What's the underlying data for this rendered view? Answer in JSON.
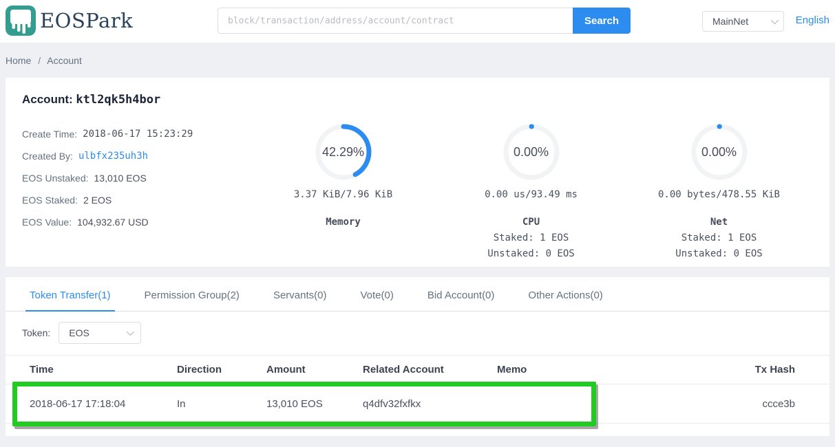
{
  "header": {
    "brand": "EOSPark",
    "search": {
      "placeholder": "block/transaction/address/account/contract",
      "button": "Search"
    },
    "network": "MainNet",
    "language": "English"
  },
  "breadcrumb": {
    "home": "Home",
    "separator": "/",
    "current": "Account"
  },
  "account": {
    "title_label": "Account:",
    "name": "ktl2qk5h4bor",
    "details": [
      {
        "label": "Create Time:",
        "value": "2018-06-17 15:23:29"
      },
      {
        "label": "Created By:",
        "value": "ulbfx235uh3h"
      },
      {
        "label": "EOS Unstaked:",
        "value": "13,010 EOS"
      },
      {
        "label": "EOS Staked:",
        "value": "2 EOS"
      },
      {
        "label": "EOS Value:",
        "value": "104,932.67 USD"
      }
    ],
    "gauges": [
      {
        "name": "Memory",
        "percent": 42.29,
        "percent_label": "42.29%",
        "usage": "3.37 KiB/7.96 KiB",
        "line1": "",
        "line2": ""
      },
      {
        "name": "CPU",
        "percent": 0,
        "percent_label": "0.00%",
        "usage": "0.00 us/93.49 ms",
        "line1": "Staked: 1 EOS",
        "line2": "Unstaked: 0 EOS"
      },
      {
        "name": "Net",
        "percent": 0,
        "percent_label": "0.00%",
        "usage": "0.00 bytes/478.55 KiB",
        "line1": "Staked: 1 EOS",
        "line2": "Unstaked: 0 EOS"
      }
    ]
  },
  "tabs": [
    {
      "label": "Token Transfer(1)",
      "active": true
    },
    {
      "label": "Permission Group(2)",
      "active": false
    },
    {
      "label": "Servants(0)",
      "active": false
    },
    {
      "label": "Vote(0)",
      "active": false
    },
    {
      "label": "Bid Account(0)",
      "active": false
    },
    {
      "label": "Other Actions(0)",
      "active": false
    }
  ],
  "token_filter": {
    "label": "Token:",
    "selected": "EOS"
  },
  "table": {
    "columns": [
      "Time",
      "Direction",
      "Amount",
      "Related Account",
      "Memo",
      "Tx Hash"
    ],
    "rows": [
      {
        "time": "2018-06-17 17:18:04",
        "direction": "In",
        "amount": "13,010 EOS",
        "related_account": "q4dfv32fxfkx",
        "memo": "",
        "tx_hash": "ccce3b",
        "highlighted": true
      }
    ]
  },
  "colors": {
    "accent_blue": "#2d8cf0",
    "brand_teal": "#359d90",
    "in_green": "#19be6b",
    "highlight_green": "#22cb22",
    "page_bg": "#eef0f4"
  }
}
